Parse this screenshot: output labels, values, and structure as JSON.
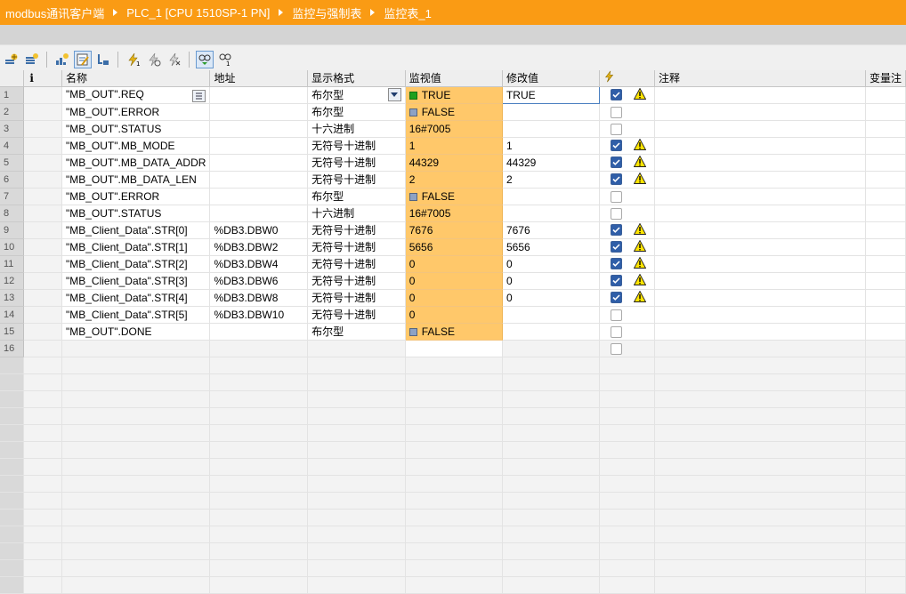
{
  "breadcrumb": [
    "modbus通讯客户端",
    "PLC_1 [CPU 1510SP-1 PN]",
    "监控与强制表",
    "监控表_1"
  ],
  "toolbar": {
    "buttons": [
      "insert-row-icon",
      "add-row-icon",
      "display-all-icon",
      "monitor-edit-icon",
      "monitor-toggle-icon",
      "modify-now-icon",
      "modify-trigger-icon",
      "force-icon",
      "monitor-all-icon",
      "monitor-once-icon"
    ]
  },
  "columns": {
    "i": "i",
    "name": "名称",
    "address": "地址",
    "format": "显示格式",
    "monitor": "监视值",
    "modify": "修改值",
    "comment": "注释",
    "var_comment": "变量注"
  },
  "rows": [
    {
      "n": "1",
      "name": "\"MB_OUT\".REQ",
      "address": "",
      "format": "布尔型",
      "monitor": "TRUE",
      "bool": "true",
      "modify": "TRUE",
      "checked": true,
      "warn": true,
      "editing": true
    },
    {
      "n": "2",
      "name": "\"MB_OUT\".ERROR",
      "address": "",
      "format": "布尔型",
      "monitor": "FALSE",
      "bool": "false",
      "modify": "",
      "checked": false,
      "warn": false
    },
    {
      "n": "3",
      "name": "\"MB_OUT\".STATUS",
      "address": "",
      "format": "十六进制",
      "monitor": "16#7005",
      "bool": "",
      "modify": "",
      "checked": false,
      "warn": false
    },
    {
      "n": "4",
      "name": "\"MB_OUT\".MB_MODE",
      "address": "",
      "format": "无符号十进制",
      "monitor": "1",
      "bool": "",
      "modify": "1",
      "checked": true,
      "warn": true
    },
    {
      "n": "5",
      "name": "\"MB_OUT\".MB_DATA_ADDR",
      "address": "",
      "format": "无符号十进制",
      "monitor": "44329",
      "bool": "",
      "modify": "44329",
      "checked": true,
      "warn": true
    },
    {
      "n": "6",
      "name": "\"MB_OUT\".MB_DATA_LEN",
      "address": "",
      "format": "无符号十进制",
      "monitor": "2",
      "bool": "",
      "modify": "2",
      "checked": true,
      "warn": true
    },
    {
      "n": "7",
      "name": "\"MB_OUT\".ERROR",
      "address": "",
      "format": "布尔型",
      "monitor": "FALSE",
      "bool": "false",
      "modify": "",
      "checked": false,
      "warn": false
    },
    {
      "n": "8",
      "name": "\"MB_OUT\".STATUS",
      "address": "",
      "format": "十六进制",
      "monitor": "16#7005",
      "bool": "",
      "modify": "",
      "checked": false,
      "warn": false
    },
    {
      "n": "9",
      "name": "\"MB_Client_Data\".STR[0]",
      "address": "%DB3.DBW0",
      "format": "无符号十进制",
      "monitor": "7676",
      "bool": "",
      "modify": "7676",
      "checked": true,
      "warn": true
    },
    {
      "n": "10",
      "name": "\"MB_Client_Data\".STR[1]",
      "address": "%DB3.DBW2",
      "format": "无符号十进制",
      "monitor": "5656",
      "bool": "",
      "modify": "5656",
      "checked": true,
      "warn": true
    },
    {
      "n": "11",
      "name": "\"MB_Client_Data\".STR[2]",
      "address": "%DB3.DBW4",
      "format": "无符号十进制",
      "monitor": "0",
      "bool": "",
      "modify": "0",
      "checked": true,
      "warn": true
    },
    {
      "n": "12",
      "name": "\"MB_Client_Data\".STR[3]",
      "address": "%DB3.DBW6",
      "format": "无符号十进制",
      "monitor": "0",
      "bool": "",
      "modify": "0",
      "checked": true,
      "warn": true
    },
    {
      "n": "13",
      "name": "\"MB_Client_Data\".STR[4]",
      "address": "%DB3.DBW8",
      "format": "无符号十进制",
      "monitor": "0",
      "bool": "",
      "modify": "0",
      "checked": true,
      "warn": true
    },
    {
      "n": "14",
      "name": "\"MB_Client_Data\".STR[5]",
      "address": "%DB3.DBW10",
      "format": "无符号十进制",
      "monitor": "0",
      "bool": "",
      "modify": "",
      "checked": false,
      "warn": false
    },
    {
      "n": "15",
      "name": "\"MB_OUT\".DONE",
      "address": "",
      "format": "布尔型",
      "monitor": "FALSE",
      "bool": "false",
      "modify": "",
      "checked": false,
      "warn": false
    },
    {
      "n": "16",
      "name": "",
      "address": "",
      "format": "",
      "monitor": "",
      "bool": "",
      "modify": "",
      "checked": false,
      "warn": false,
      "empty": true
    }
  ],
  "colors": {
    "title_bar": "#fa9b14",
    "monitor_cell": "#ffc86a",
    "bool_true": "#1ea01e",
    "bool_false": "#8da2c4"
  }
}
